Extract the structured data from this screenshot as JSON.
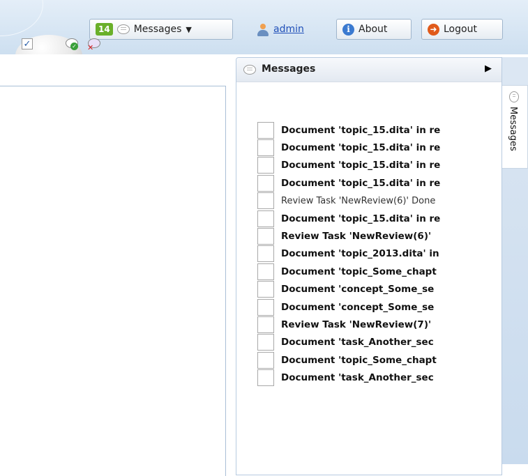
{
  "header": {
    "messages_count": "14",
    "messages_label": "Messages",
    "user": "admin",
    "about_label": "About",
    "logout_label": "Logout"
  },
  "messages_panel": {
    "title": "Messages",
    "side_tab_label": "Messages",
    "items": [
      {
        "text": "Document 'topic_15.dita' in re",
        "bold": true
      },
      {
        "text": "Document 'topic_15.dita' in re",
        "bold": true
      },
      {
        "text": "Document 'topic_15.dita' in re",
        "bold": true
      },
      {
        "text": "Document 'topic_15.dita' in re",
        "bold": true
      },
      {
        "text": "Review Task 'NewReview(6)'  Done",
        "bold": false
      },
      {
        "text": "Document 'topic_15.dita' in re",
        "bold": true
      },
      {
        "text": "Review Task 'NewReview(6)'",
        "bold": true
      },
      {
        "text": "Document 'topic_2013.dita' in",
        "bold": true
      },
      {
        "text": "Document 'topic_Some_chapt",
        "bold": true
      },
      {
        "text": "Document 'concept_Some_se",
        "bold": true
      },
      {
        "text": "Document 'concept_Some_se",
        "bold": true
      },
      {
        "text": "Review Task 'NewReview(7)'",
        "bold": true
      },
      {
        "text": "Document 'task_Another_sec",
        "bold": true
      },
      {
        "text": "Document 'topic_Some_chapt",
        "bold": true
      },
      {
        "text": "Document 'task_Another_sec",
        "bold": true
      }
    ]
  },
  "colors": {
    "badge": "#6ab02a",
    "link": "#1f4fb8",
    "header_bg": "#cddff0"
  }
}
